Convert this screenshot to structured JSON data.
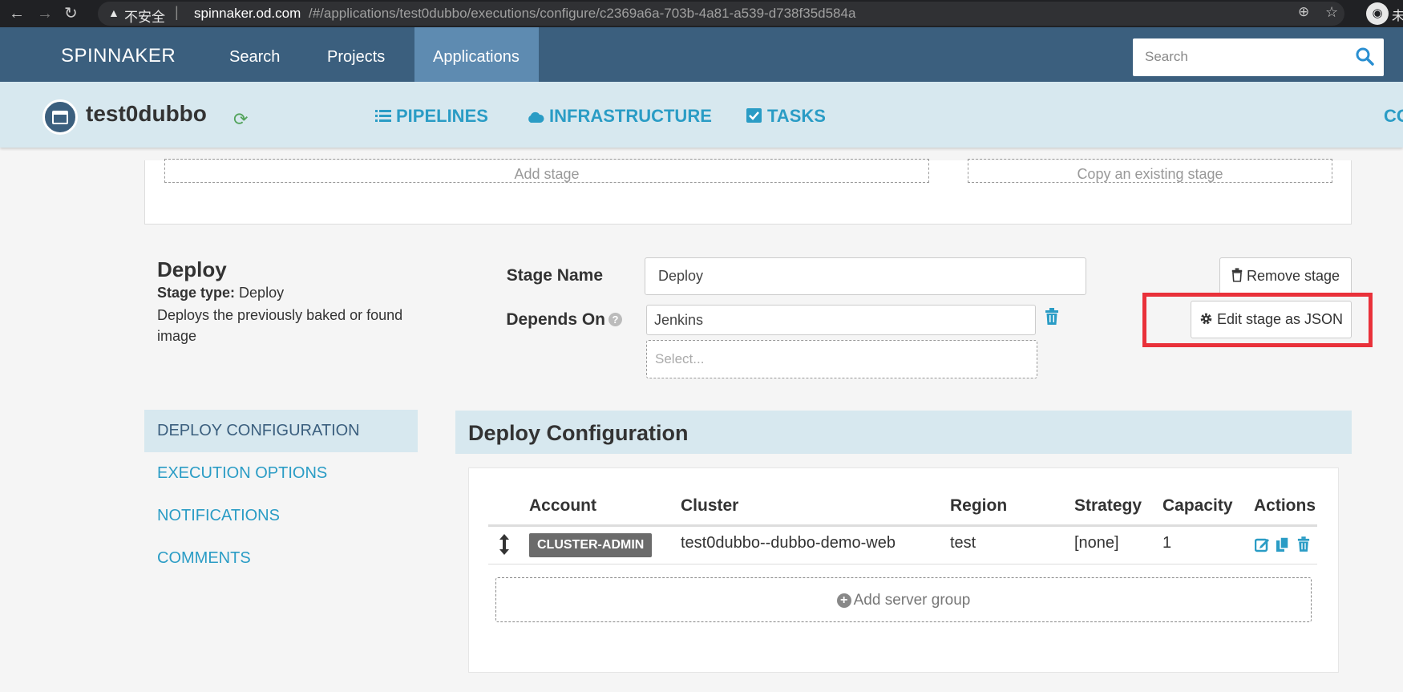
{
  "browser": {
    "insecure_label": "不安全",
    "separator": "|",
    "url_host": "spinnaker.od.com",
    "url_path": "/#/applications/test0dubbo/executions/configure/c2369a6a-703b-4a81-a539-d738f35d584a",
    "profile_text": "未"
  },
  "topnav": {
    "brand": "SPINNAKER",
    "items": [
      {
        "label": "Search"
      },
      {
        "label": "Projects"
      },
      {
        "label": "Applications",
        "active": true
      }
    ],
    "search_placeholder": "Search"
  },
  "app": {
    "name": "test0dubbo",
    "nav": [
      {
        "label": "PIPELINES",
        "icon": "list-icon"
      },
      {
        "label": "INFRASTRUCTURE",
        "icon": "cloud-icon"
      },
      {
        "label": "TASKS",
        "icon": "check-square-icon"
      }
    ],
    "nav_clipped": "CO"
  },
  "top_card": {
    "add_stage": "Add stage",
    "copy_stage": "Copy an existing stage"
  },
  "stage": {
    "title": "Deploy",
    "type_label": "Stage type:",
    "type_value": "Deploy",
    "description": "Deploys the previously baked or found image",
    "name_label": "Stage Name",
    "name_value": "Deploy",
    "depends_label": "Depends On",
    "depends_value": "Jenkins",
    "depends_placeholder": "Select...",
    "remove_label": "Remove stage",
    "edit_json_label": "Edit stage as JSON"
  },
  "sidenav": [
    {
      "label": "DEPLOY CONFIGURATION",
      "active": true
    },
    {
      "label": "EXECUTION OPTIONS"
    },
    {
      "label": "NOTIFICATIONS"
    },
    {
      "label": "COMMENTS"
    }
  ],
  "deploy": {
    "heading": "Deploy Configuration",
    "columns": [
      "Account",
      "Cluster",
      "Region",
      "Strategy",
      "Capacity",
      "Actions"
    ],
    "rows": [
      {
        "account": "CLUSTER-ADMIN",
        "cluster": "test0dubbo--dubbo-demo-web",
        "region": "test",
        "strategy": "[none]",
        "capacity": "1"
      }
    ],
    "add_server_group": "Add server group"
  },
  "colors": {
    "topnav": "#3b5f7e",
    "topnav_active": "#5e8bb1",
    "header": "#d7e8ef",
    "accent": "#2a9cc5",
    "highlight": "#e9313a"
  }
}
